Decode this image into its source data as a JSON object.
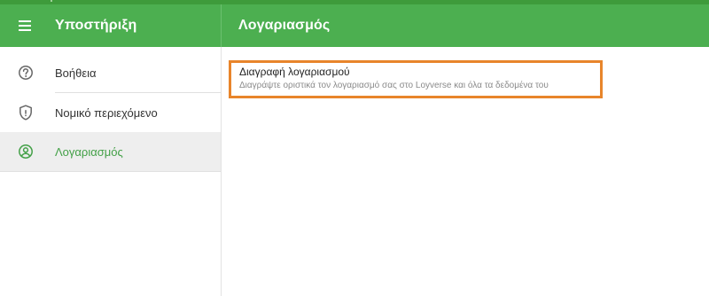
{
  "app": {
    "accent": "#4caf50",
    "accent_dark": "#3e9b3b",
    "highlight": "#e8852b"
  },
  "appbar": {
    "left_title": "Υποστήριξη",
    "right_title": "Λογαριασμός",
    "menu_icon": "hamburger-menu-icon"
  },
  "sidebar": {
    "items": [
      {
        "label": "Βοήθεια",
        "icon": "help-circle-icon",
        "active": false
      },
      {
        "label": "Νομικό περιεχόμενο",
        "icon": "shield-icon",
        "active": false
      },
      {
        "label": "Λογαριασμός",
        "icon": "account-circle-icon",
        "active": true
      }
    ]
  },
  "content": {
    "delete_account": {
      "title": "Διαγραφή λογαριασμού",
      "subtitle": "Διαγράψτε οριστικά τον λογαριασμό σας στο Loyverse και όλα τα δεδομένα του"
    }
  }
}
